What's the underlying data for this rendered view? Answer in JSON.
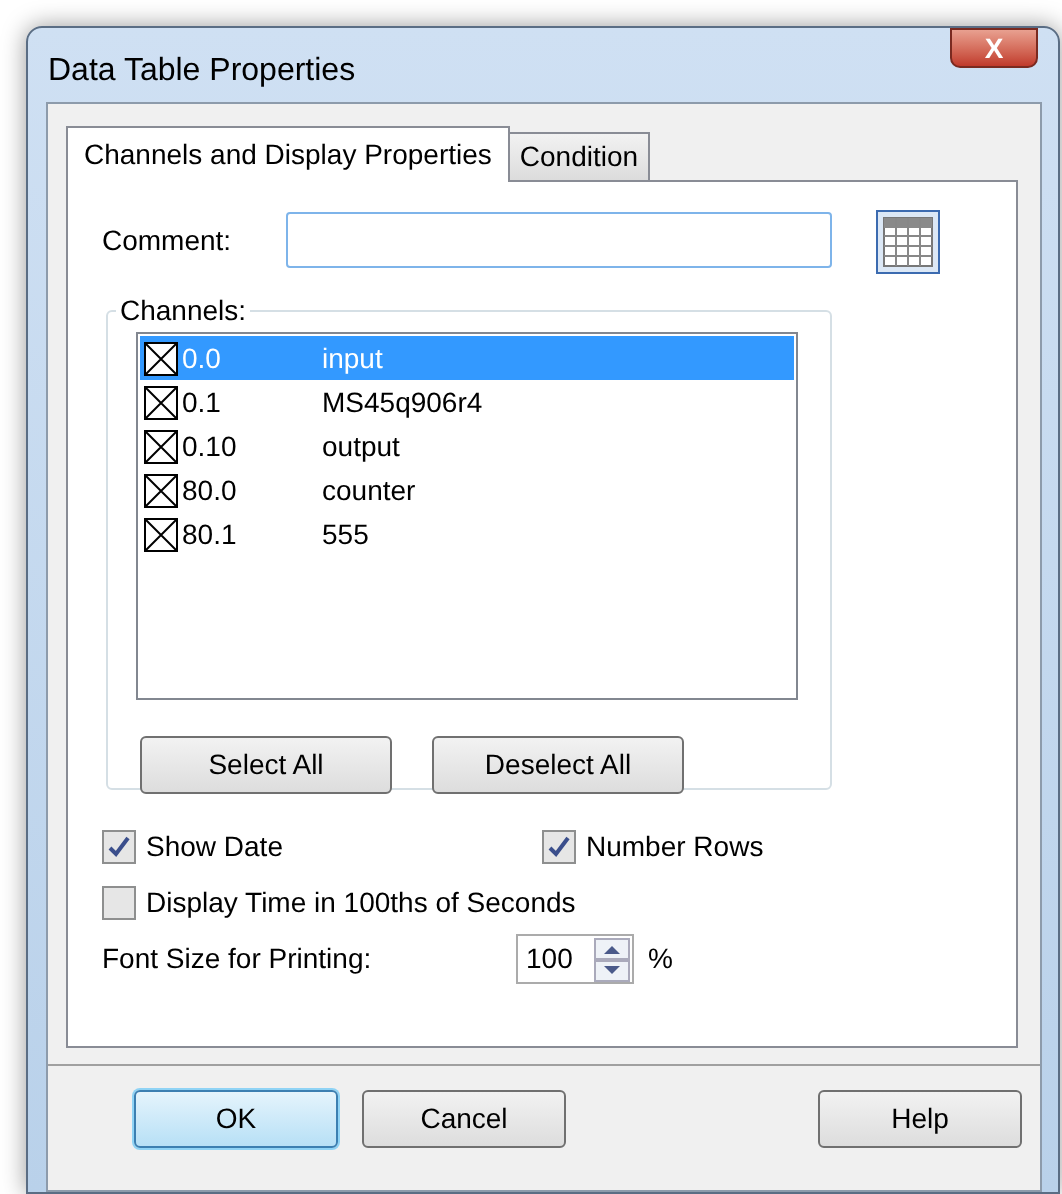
{
  "window": {
    "title": "Data Table Properties",
    "close": "X"
  },
  "tabs": [
    {
      "label": "Channels and Display Properties",
      "selected": true
    },
    {
      "label": "Condition",
      "selected": false
    }
  ],
  "comment": {
    "label": "Comment:"
  },
  "channels": {
    "label": "Channels:",
    "items": [
      {
        "address": "0.0",
        "name": "input",
        "checked": true,
        "selected": true
      },
      {
        "address": "0.1",
        "name": "MS45q906r4",
        "checked": true,
        "selected": false
      },
      {
        "address": "0.10",
        "name": "output",
        "checked": true,
        "selected": false
      },
      {
        "address": "80.0",
        "name": "counter",
        "checked": true,
        "selected": false
      },
      {
        "address": "80.1",
        "name": "555",
        "checked": true,
        "selected": false
      }
    ],
    "buttons": [
      "Select All",
      "Deselect All"
    ]
  },
  "options": [
    {
      "label": "Show Date",
      "checked": true
    },
    {
      "label": "Number Rows",
      "checked": true
    },
    {
      "label": "Display Time in 100ths of Seconds",
      "checked": false
    }
  ],
  "font_size": {
    "label": "Font Size for Printing:",
    "value": "100",
    "unit": "%"
  },
  "buttons": [
    {
      "label": "OK",
      "default": true
    },
    {
      "label": "Cancel",
      "default": false
    },
    {
      "label": "Help",
      "default": false
    }
  ]
}
